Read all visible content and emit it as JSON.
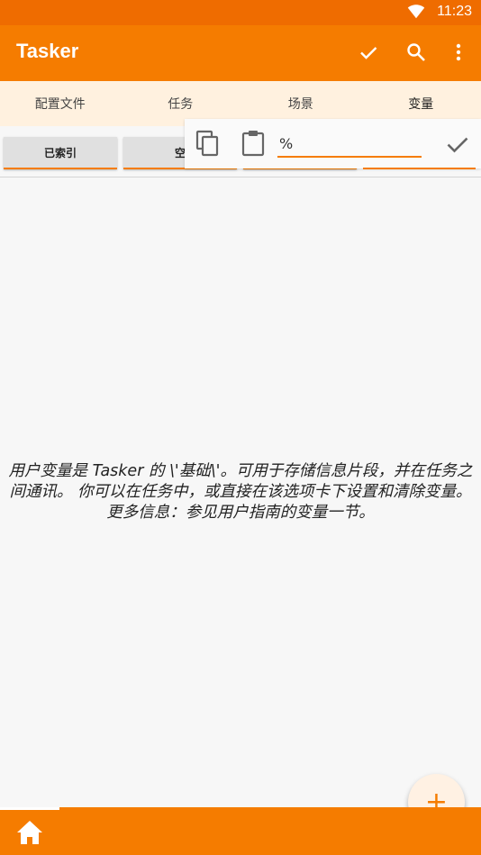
{
  "status_bar": {
    "time": "11:23",
    "icon": "wifi-icon"
  },
  "app_bar": {
    "title": "Tasker",
    "actions": [
      {
        "name": "check-icon",
        "label": "✓"
      },
      {
        "name": "search-icon",
        "label": "search"
      },
      {
        "name": "more-vert-icon",
        "label": "more"
      }
    ]
  },
  "tabs": [
    {
      "label": "配置文件"
    },
    {
      "label": "任务"
    },
    {
      "label": "场景"
    },
    {
      "label": "变量",
      "active": true
    }
  ],
  "filter_buttons": [
    {
      "label": "已索引"
    },
    {
      "label": "空"
    }
  ],
  "filter_popup": {
    "input_value": "%",
    "icons": [
      "copy-icon",
      "clipboard-icon",
      "confirm-check-icon"
    ]
  },
  "help_text": "用户变量是 Tasker 的 \\'基础\\'。可用于存储信息片段，并在任务之间通讯。 你可以在任务中，或直接在该选项卡下设置和清除变量。 更多信息：参见用户指南的变量一节。",
  "fab": {
    "label": "+"
  },
  "bottom_bar": {
    "icon": "home-icon"
  },
  "colors": {
    "accent": "#f57c00",
    "status_bar": "#ef6c00",
    "tab_bg": "#fff1df",
    "background": "#f7f7f7"
  }
}
